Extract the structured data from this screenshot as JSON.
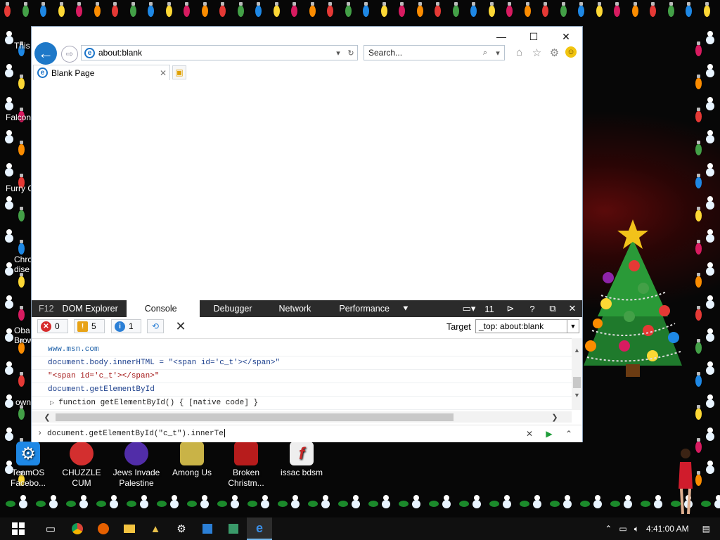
{
  "desktop": {
    "icons": [
      {
        "label": "TeamOS Facebo...",
        "color": "#1e88e5"
      },
      {
        "label": "CHUZZLE CUM",
        "color": "#d32f2f"
      },
      {
        "label": "Jews Invade Palestine",
        "color": "#512da8"
      },
      {
        "label": "Among Us",
        "color": "#c9b347"
      },
      {
        "label": "Broken Christm...",
        "color": "#b71c1c"
      },
      {
        "label": "issac bdsm",
        "color": "#c62828"
      }
    ],
    "left_partial_labels": [
      "This",
      "Falcon",
      "Furry C",
      "Chro dise",
      "Oba Brow",
      "own",
      "TeamOS"
    ]
  },
  "browser": {
    "address": "about:blank",
    "search_placeholder": "Search...",
    "tab_title": "Blank Page",
    "title_buttons": {
      "minimize": "—",
      "maximize": "☐",
      "close": "✕"
    }
  },
  "devtools": {
    "f12_label": "F12",
    "tabs": [
      "DOM Explorer",
      "Console",
      "Debugger",
      "Network",
      "Performance"
    ],
    "active_tab": "Console",
    "doc_mode": "11",
    "counts": {
      "errors": "0",
      "warnings": "5",
      "info": "1"
    },
    "target_label": "Target",
    "target_value": "_top: about:blank",
    "console_lines": [
      "www.msn.com",
      "document.body.innerHTML = \"<span id='c_t'></span>\"",
      "\"<span id='c_t'></span>\"",
      "document.getElementById",
      "function getElementById() { [native code] }"
    ],
    "input_text": "document.getElementById(\"c_t\").innerTe"
  },
  "taskbar": {
    "time": "4:41:00 AM"
  }
}
